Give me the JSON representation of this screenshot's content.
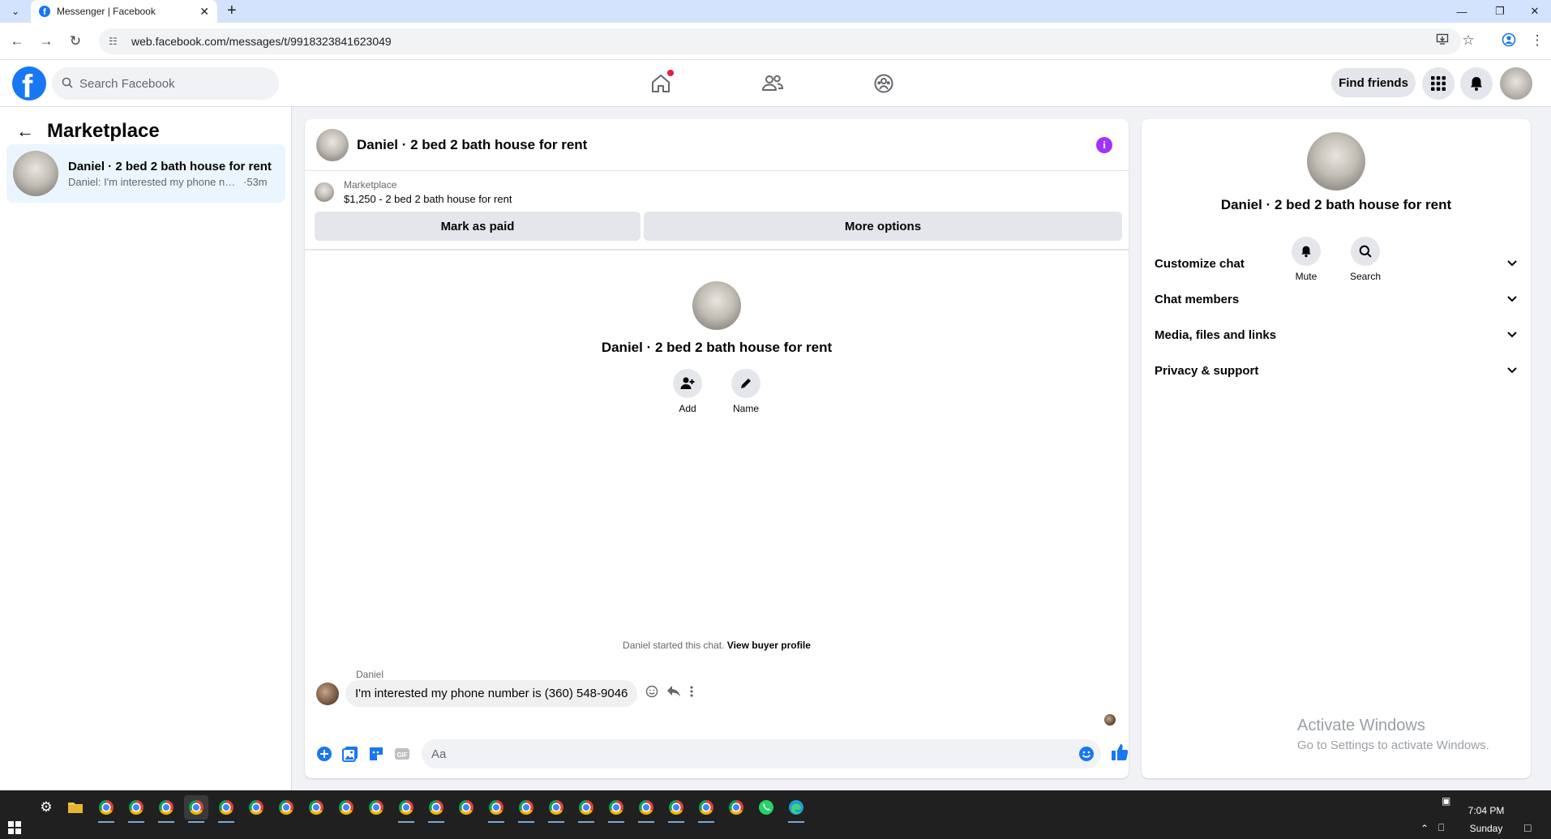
{
  "browser": {
    "tab_title": "Messenger | Facebook",
    "url": "web.facebook.com/messages/t/9918323841623049"
  },
  "fb": {
    "search_placeholder": "Search Facebook",
    "find_friends_label": "Find friends"
  },
  "sidebar": {
    "title": "Marketplace",
    "conversations": [
      {
        "name": "Daniel · 2 bed 2 bath house for rent",
        "snippet": "Daniel: I'm interested my phone nu...",
        "time": "·53m"
      }
    ]
  },
  "chat": {
    "title": "Daniel · 2 bed 2 bath house for rent",
    "marketplace_label": "Marketplace",
    "listing": "$1,250 - 2 bed 2 bath house for rent",
    "mark_paid_label": "Mark as paid",
    "more_options_label": "More options",
    "intro_title": "Daniel · 2 bed 2 bath house for rent",
    "intro_actions": [
      "Add",
      "Name"
    ],
    "started_text": "Daniel started this chat.",
    "view_buyer_label": "View buyer profile",
    "sender": "Daniel",
    "message": "I'm interested my phone number is (360) 548-9046",
    "composer_placeholder": "Aa"
  },
  "info_panel": {
    "title": "Daniel · 2 bed 2 bath house for rent",
    "actions": [
      "Mute",
      "Search"
    ],
    "sections": [
      "Customize chat",
      "Chat members",
      "Media, files and links",
      "Privacy & support"
    ]
  },
  "watermark": {
    "line1": "Activate Windows",
    "line2": "Go to Settings to activate Windows."
  },
  "taskbar": {
    "time": "7:04 PM",
    "day": "Sunday"
  },
  "colors": {
    "fb_blue": "#1877f2",
    "info_purple": "#a033ff",
    "selected_conversation": "#ebf5ff"
  }
}
